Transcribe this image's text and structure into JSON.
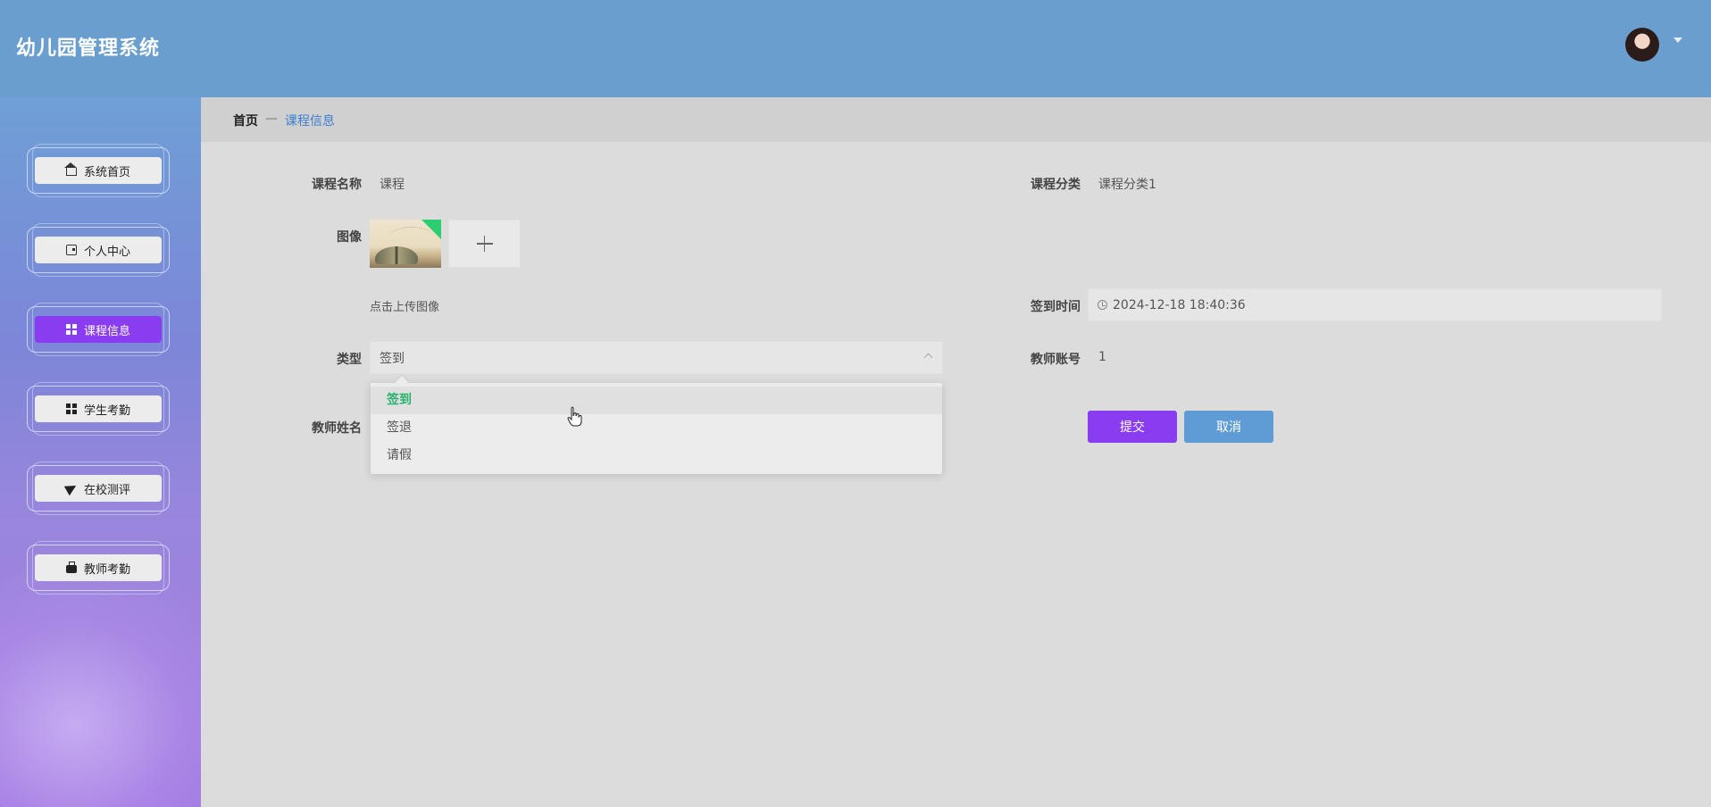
{
  "app": {
    "title": "幼儿园管理系统"
  },
  "header": {
    "avatar_icon": "user-avatar",
    "caret_icon": "caret-down-icon"
  },
  "sidebar": {
    "items": [
      {
        "label": "系统首页",
        "icon": "home-icon",
        "active": false
      },
      {
        "label": "个人中心",
        "icon": "card-icon",
        "active": false
      },
      {
        "label": "课程信息",
        "icon": "grid-icon",
        "active": true
      },
      {
        "label": "学生考勤",
        "icon": "grid-icon",
        "active": false
      },
      {
        "label": "在校测评",
        "icon": "send-icon",
        "active": false
      },
      {
        "label": "教师考勤",
        "icon": "briefcase-icon",
        "active": false
      }
    ]
  },
  "breadcrumb": {
    "home": "首页",
    "separator": "—",
    "current": "课程信息"
  },
  "form": {
    "course_name": {
      "label": "课程名称",
      "value": "课程"
    },
    "course_category": {
      "label": "课程分类",
      "value": "课程分类1"
    },
    "image": {
      "label": "图像",
      "hint": "点击上传图像"
    },
    "checkin_time": {
      "label": "签到时间",
      "value": "2024-12-18 18:40:36"
    },
    "type": {
      "label": "类型",
      "value": "签到",
      "options": [
        "签到",
        "签退",
        "请假"
      ],
      "selected": "签到"
    },
    "teacher_account": {
      "label": "教师账号",
      "value": "1"
    },
    "teacher_name": {
      "label": "教师姓名"
    },
    "submit_label": "提交",
    "cancel_label": "取消"
  },
  "colors": {
    "header": "#6a9ece",
    "accent": "#8a3df0",
    "cancel": "#5f9cd6",
    "selected_option": "#27b36b",
    "breadcrumb_current": "#3a7fd0"
  }
}
